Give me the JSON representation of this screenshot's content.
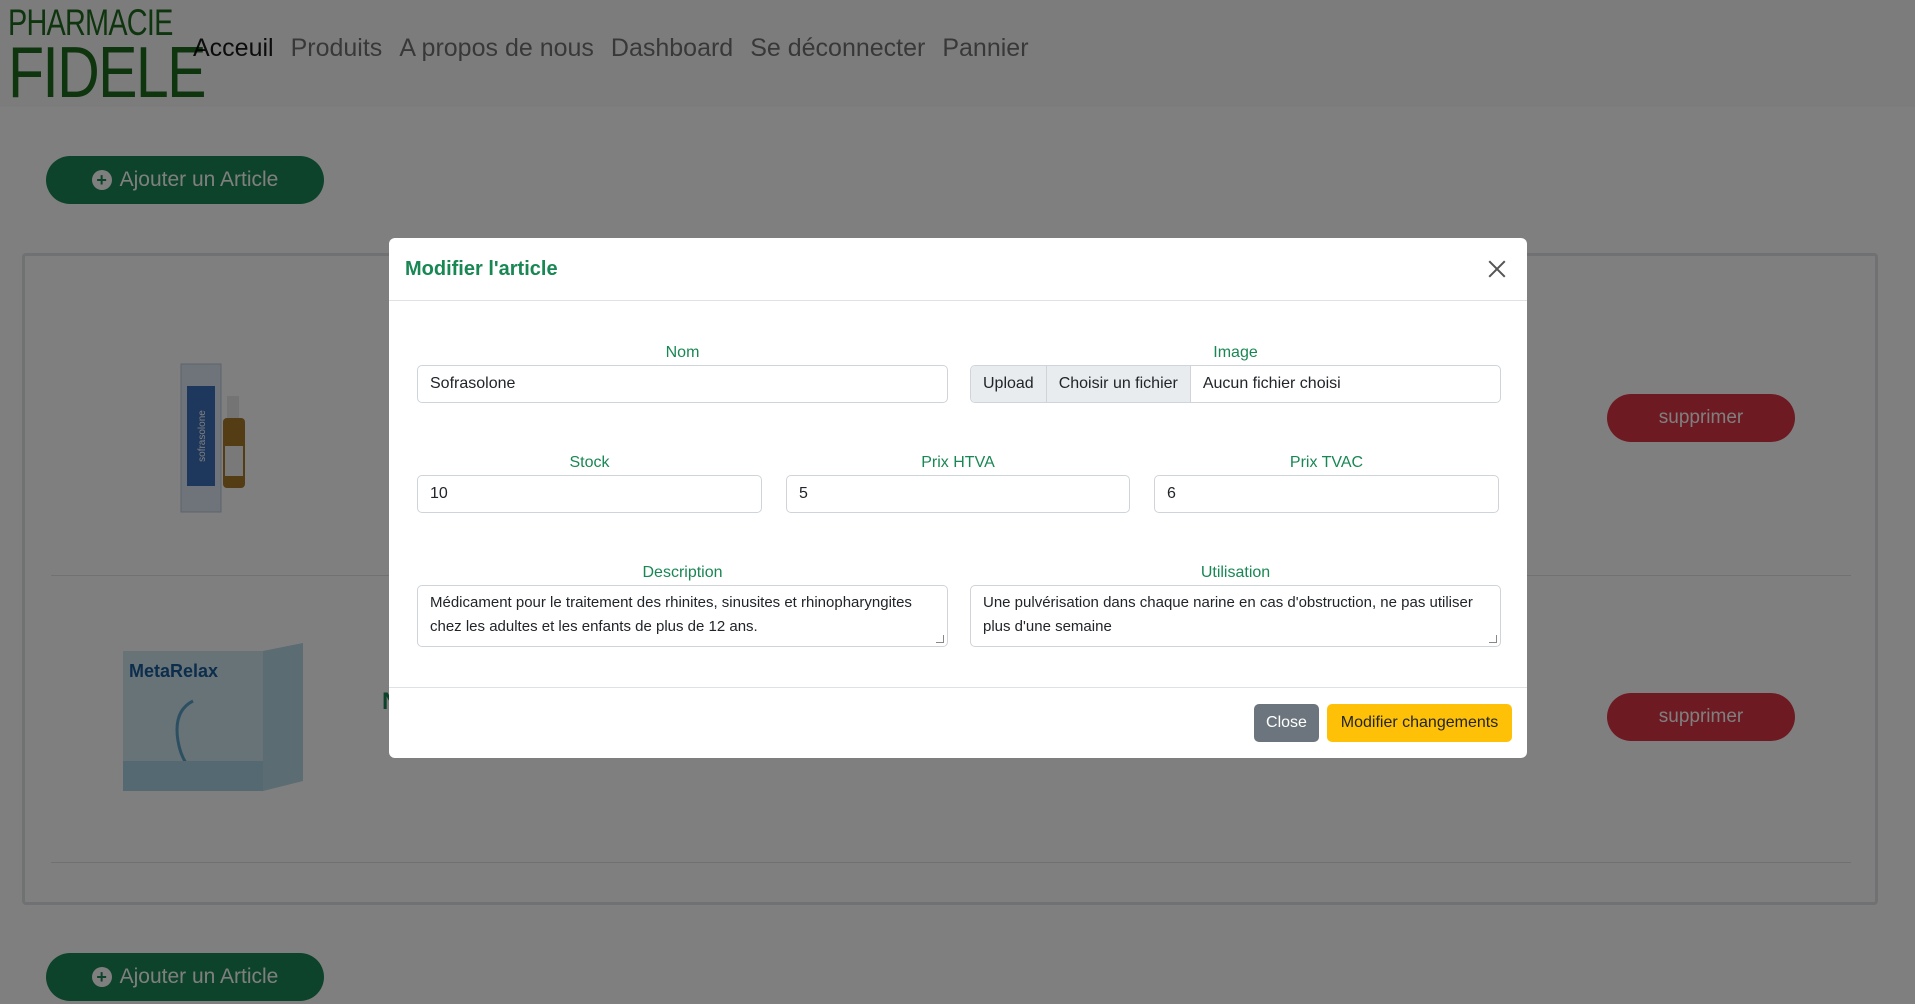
{
  "brand": {
    "line1": "PHARMACIE",
    "line2": "FIDELE",
    "color": "#1f6b1f"
  },
  "nav": {
    "items": [
      {
        "label": "Acceuil",
        "active": true
      },
      {
        "label": "Produits"
      },
      {
        "label": "A propos de nous"
      },
      {
        "label": "Dashboard"
      },
      {
        "label": "Se déconnecter"
      },
      {
        "label": "Pannier"
      }
    ]
  },
  "page": {
    "add_label": "Ajouter un Article",
    "delete_label": "supprimer",
    "products": [
      {
        "image_text": "sofrasolone"
      },
      {
        "image_text": "MetaRelax",
        "name_fragment": "N"
      }
    ]
  },
  "modal": {
    "title": "Modifier l'article",
    "fields": {
      "nom": {
        "label": "Nom",
        "value": "Sofrasolone"
      },
      "image": {
        "label": "Image",
        "upload_label": "Upload",
        "choose_label": "Choisir un fichier",
        "status": "Aucun fichier choisi"
      },
      "stock": {
        "label": "Stock",
        "value": "10"
      },
      "prix_htva": {
        "label": "Prix HTVA",
        "value": "5"
      },
      "prix_tvac": {
        "label": "Prix TVAC",
        "value": "6"
      },
      "description": {
        "label": "Description",
        "value": "Médicament pour le traitement des rhinites, sinusites et rhinopharyngites chez les adultes et les enfants de plus de 12 ans."
      },
      "utilisation": {
        "label": "Utilisation",
        "value": "Une pulvérisation dans chaque narine en cas d'obstruction, ne pas utiliser plus d'une semaine"
      }
    },
    "close_label": "Close",
    "save_label": "Modifier changements"
  },
  "colors": {
    "success": "#198754",
    "danger": "#dc3545",
    "warning": "#ffc107",
    "secondary": "#6c757d"
  }
}
